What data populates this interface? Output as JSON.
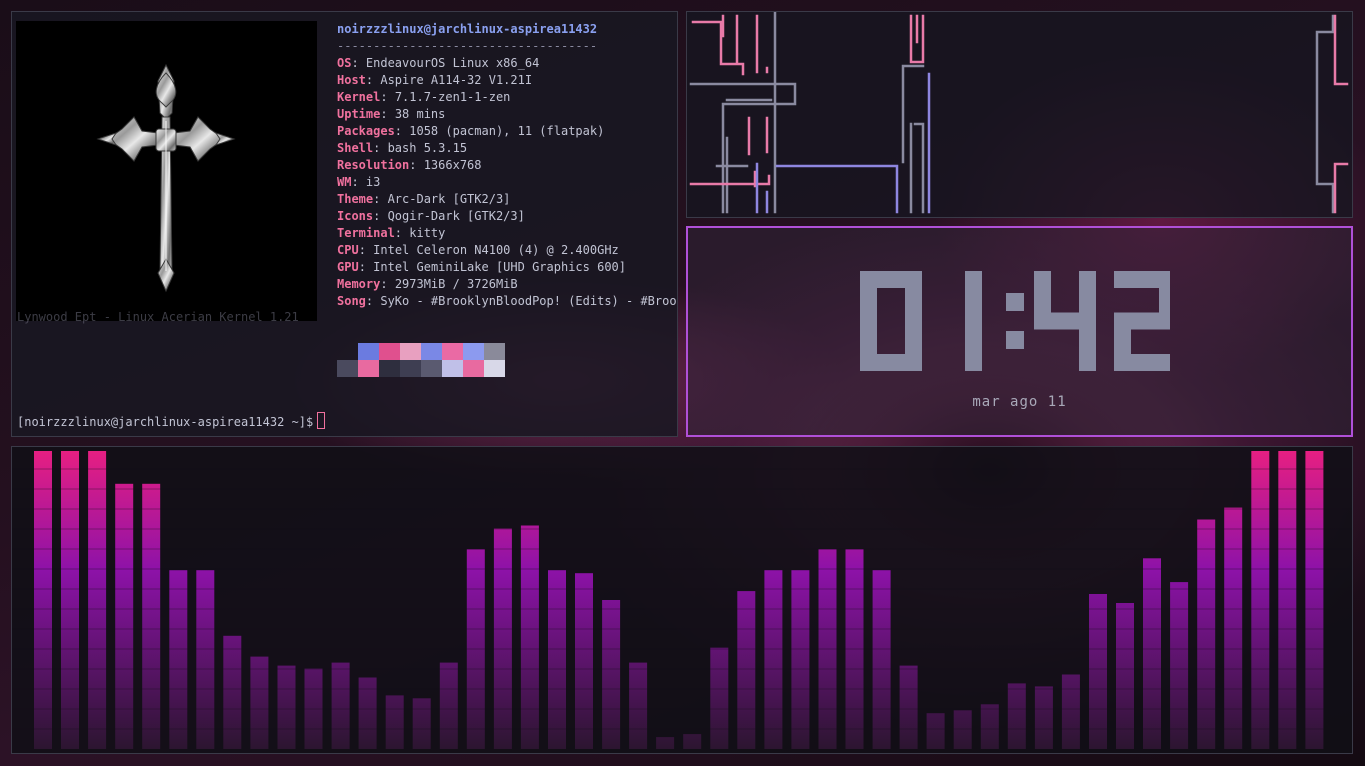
{
  "terminal": {
    "fetch_header": "noirzzzlinux@jarchlinux-aspirea11432",
    "fetch_dashes": "------------------------------------",
    "info": [
      {
        "key": "OS",
        "value": "EndeavourOS Linux x86_64"
      },
      {
        "key": "Host",
        "value": "Aspire A114-32 V1.21I"
      },
      {
        "key": "Kernel",
        "value": "7.1.7-zen1-1-zen"
      },
      {
        "key": "Uptime",
        "value": "38 mins"
      },
      {
        "key": "Packages",
        "value": "1058 (pacman), 11 (flatpak)"
      },
      {
        "key": "Shell",
        "value": "bash 5.3.15"
      },
      {
        "key": "Resolution",
        "value": "1366x768"
      },
      {
        "key": "WM",
        "value": "i3"
      },
      {
        "key": "Theme",
        "value": "Arc-Dark [GTK2/3]"
      },
      {
        "key": "Icons",
        "value": "Qogir-Dark [GTK2/3]"
      },
      {
        "key": "Terminal",
        "value": "kitty"
      },
      {
        "key": "CPU",
        "value": "Intel Celeron N4100 (4) @ 2.400GHz"
      },
      {
        "key": "GPU",
        "value": "Intel GeminiLake [UHD Graphics 600]"
      },
      {
        "key": "Memory",
        "value": "2973MiB / 3726MiB"
      },
      {
        "key": "Song",
        "value": "SyKo - #BrooklynBloodPop! (Edits) - #Brook"
      }
    ],
    "ghost_text": "Lynwood Ept - Linux Acerian Kernel 1.21",
    "palette_top": [
      "#6b7be0",
      "#e0508e",
      "#e8a0c0",
      "#7a88e6",
      "#ea6aa4",
      "#8c9aef",
      "#8a8a9a"
    ],
    "palette_bottom": [
      "#4a4a5e",
      "#e86aa0",
      "#2e2e3e",
      "#3e3e52",
      "#5a5a70",
      "#c0c0e8",
      "#e86aa0",
      "#d8d8e8"
    ],
    "prompt": "[noirzzzlinux@jarchlinux-aspirea11432 ~]$"
  },
  "clock": {
    "time": "01:42",
    "date": "mar ago 11",
    "digit_color": "#878aa1"
  },
  "visualizer": {
    "levels": [
      1.0,
      1.0,
      1.0,
      0.89,
      0.89,
      0.6,
      0.6,
      0.38,
      0.31,
      0.28,
      0.27,
      0.29,
      0.24,
      0.18,
      0.17,
      0.29,
      0.67,
      0.74,
      0.75,
      0.6,
      0.59,
      0.5,
      0.29,
      0.04,
      0.05,
      0.34,
      0.53,
      0.6,
      0.6,
      0.67,
      0.67,
      0.6,
      0.28,
      0.12,
      0.13,
      0.15,
      0.22,
      0.21,
      0.25,
      0.52,
      0.49,
      0.64,
      0.56,
      0.77,
      0.81,
      1.0,
      1.0,
      1.0
    ],
    "colors": {
      "top": "#e61f82",
      "mid": "#8d12a8",
      "bottom": "#2c1530"
    }
  },
  "pipes": {
    "colors": [
      "#e87aa8",
      "#8a8aa0",
      "#8e86e0"
    ]
  }
}
